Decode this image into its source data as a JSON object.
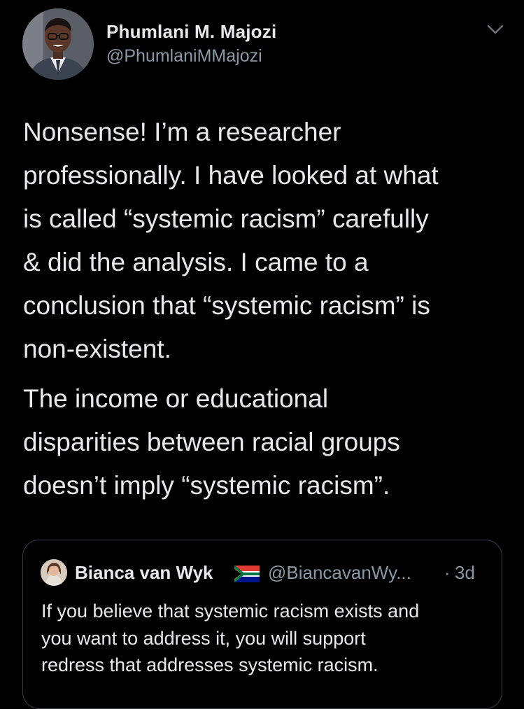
{
  "tweet": {
    "author": {
      "name": "Phumlani M. Majozi",
      "handle": "@PhumlaniMMajozi",
      "avatar_icon": "profile-photo"
    },
    "menu_icon": "chevron-down-icon",
    "paragraphs": [
      "Nonsense! I’m a researcher\nprofessionally. I have looked at what\nis called “systemic racism” carefully\n& did the analysis. I came to a\nconclusion that “systemic racism” is\nnon-existent.",
      "The income or educational\ndisparities between racial groups\ndoesn’t imply “systemic racism”."
    ],
    "quoted_tweet": {
      "author_name": "Bianca van Wyk",
      "flag_icon": "south-africa-flag-icon",
      "handle": "@BiancavanWy...",
      "separator": "·",
      "time": "3d",
      "text": "If you believe that systemic racism exists and\nyou want to address it, you will support\nredress that addresses systemic racism."
    }
  },
  "colors": {
    "background": "#000000",
    "text_primary": "#e7e9ea",
    "text_secondary": "#8b98a5",
    "card_border": "#3a3f44"
  }
}
